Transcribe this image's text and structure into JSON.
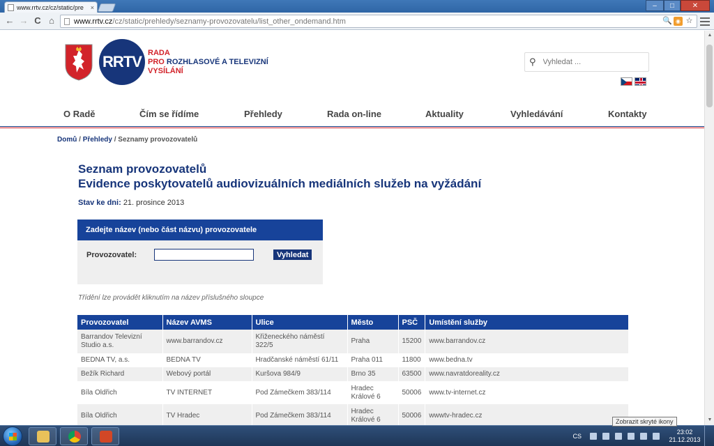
{
  "browser": {
    "tab_title": "www.rrtv.cz/cz/static/pre",
    "tab_close": "×",
    "url_host": "www.rrtv.cz",
    "url_path": "/cz/static/prehledy/seznamy-provozovatelu/list_other_ondemand.htm",
    "back": "←",
    "forward": "→",
    "reload": "C",
    "home": "⌂"
  },
  "header": {
    "logo_abbr": "RRTV",
    "logo_line1": "RADA",
    "logo_line2_part1": "PRO",
    "logo_line2_part2": "ROZHLASOVÉ A TELEVIZNÍ",
    "logo_line3": "VYSÍLÁNÍ",
    "search_placeholder": "Vyhledat ..."
  },
  "nav": [
    "O Radě",
    "Čím se řídíme",
    "Přehledy",
    "Rada on-line",
    "Aktuality",
    "Vyhledávání",
    "Kontakty"
  ],
  "breadcrumb": {
    "home": "Domů",
    "sep": " / ",
    "section": "Přehledy",
    "current": "Seznamy provozovatelů"
  },
  "page": {
    "title_line1": "Seznam provozovatelů",
    "title_line2": "Evidence poskytovatelů audiovizuálních mediálních služeb na vyžádání",
    "state_label": "Stav ke dni:",
    "state_value": "21. prosince 2013",
    "search_head": "Zadejte název (nebo část názvu) provozovatele",
    "search_label": "Provozovatel:",
    "search_button": "Vyhledat",
    "sort_note": "Třídění lze provádět kliknutím na název příslušného sloupce"
  },
  "table": {
    "headers": [
      "Provozovatel",
      "Název AVMS",
      "Ulice",
      "Město",
      "PSČ",
      "Umístění služby"
    ],
    "rows": [
      [
        "Barrandov Televizní Studio a.s.",
        "www.barrandov.cz",
        "Křiženeckého náměstí 322/5",
        "Praha",
        "15200",
        "www.barrandov.cz"
      ],
      [
        "BEDNA TV, a.s.",
        "BEDNA TV",
        "Hradčanské náměstí 61/11",
        "Praha 011",
        "11800",
        "www.bedna.tv"
      ],
      [
        "Bežík Richard",
        "Webový portál",
        "Kuršova 984/9",
        "Brno 35",
        "63500",
        "www.navratdoreality.cz"
      ],
      [
        "Bíla Oldřich",
        "TV INTERNET",
        "Pod Zámečkem 383/114",
        "Hradec Králové 6",
        "50006",
        "www.tv-internet.cz"
      ],
      [
        "Bíla Oldřich",
        "TV Hradec",
        "Pod Zámečkem 383/114",
        "Hradec Králové 6",
        "50006",
        "wwwtv-hradec.cz"
      ]
    ]
  },
  "taskbar": {
    "lang": "CS",
    "time": "23:02",
    "date": "21.12.2013",
    "tooltip": "Zobrazit skryté ikony"
  }
}
